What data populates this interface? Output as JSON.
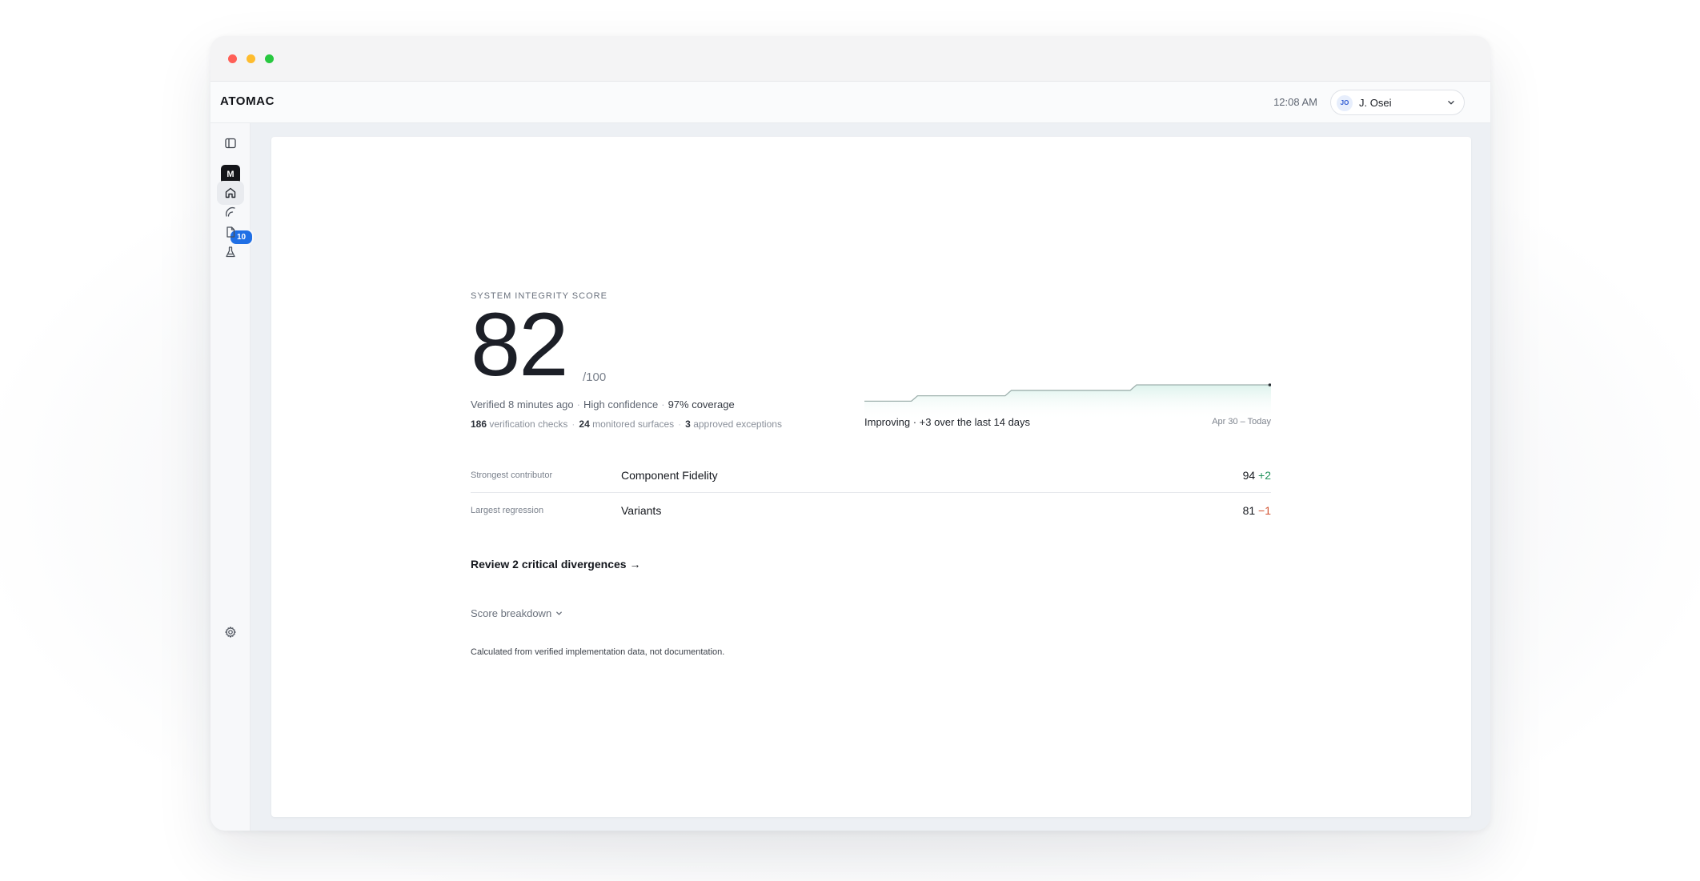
{
  "app": {
    "brand": "ATOMAC",
    "clock": "12:08 AM",
    "user": {
      "initials": "JO",
      "name": "J. Osei"
    }
  },
  "rail": {
    "workspace_initial": "M",
    "notifications_count": "10",
    "icons": [
      "sidebar-toggle-icon",
      "home-icon",
      "broadcast-icon",
      "document-icon",
      "flask-icon",
      "gear-icon"
    ]
  },
  "score": {
    "eyebrow": "SYSTEM INTEGRITY SCORE",
    "value": "82",
    "max": "/100",
    "verified": "Verified 8 minutes ago",
    "confidence": "High confidence",
    "coverage": "97% coverage",
    "checks_count": "186",
    "checks_label": "verification checks",
    "surfaces_count": "24",
    "surfaces_label": "monitored surfaces",
    "exceptions_count": "3",
    "exceptions_label": "approved exceptions"
  },
  "trend": {
    "summary": "Improving · +3 over the last 14 days",
    "range": "Apr 30 – Today",
    "points": [
      79,
      79,
      80,
      80,
      80,
      81,
      81,
      81,
      81,
      82,
      82,
      82,
      82,
      82
    ]
  },
  "contributors": [
    {
      "label": "Strongest contributor",
      "name": "Component Fidelity",
      "score": "94",
      "delta": "+2"
    },
    {
      "label": "Largest regression",
      "name": "Variants",
      "score": "81",
      "delta": "−1"
    }
  ],
  "cta": "Review 2 critical divergences →",
  "breakdown_label": "Score breakdown",
  "footnote": "Calculated from verified implementation data, not documentation.",
  "colors": {
    "accent": "#1f6fe5",
    "positive": "#22925b",
    "negative": "#d2512f",
    "spark": "#9fb1ae"
  }
}
